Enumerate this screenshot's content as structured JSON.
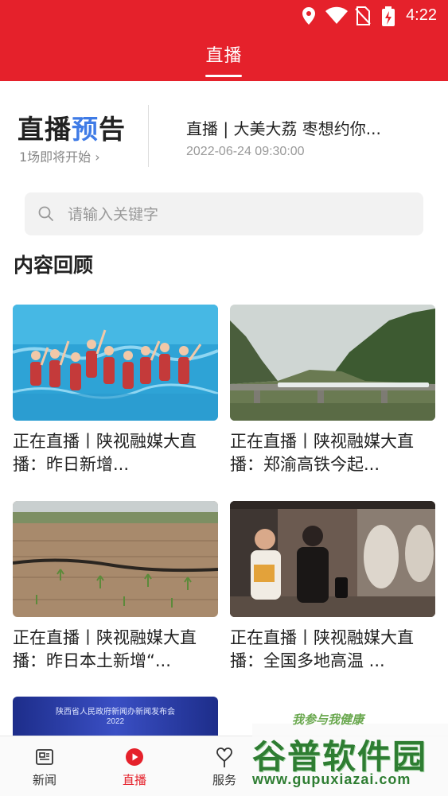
{
  "status_bar": {
    "time": "4:22"
  },
  "header": {
    "title": "直播"
  },
  "preview": {
    "title_part1": "直播",
    "title_part2": "预",
    "title_part3": "告",
    "subtitle": "1场即将开始 ›",
    "item_title": "直播 | 大美大荔 枣想约你...",
    "item_time": "2022-06-24 09:30:00"
  },
  "search": {
    "placeholder": "请输入关键字"
  },
  "section": {
    "title": "内容回顾"
  },
  "cards": [
    {
      "title": "正在直播丨陕视融媒大直播：昨日新增..."
    },
    {
      "title": "正在直播丨陕视融媒大直播：郑渝高铁今起..."
    },
    {
      "title": "正在直播丨陕视融媒大直播：昨日本土新增“..."
    },
    {
      "title": "正在直播丨陕视融媒大直播：全国多地高温 ..."
    }
  ],
  "partial_card": {
    "org": "陕西省人民政府新闻办新闻发布会",
    "year": "2022"
  },
  "tabs": [
    {
      "label": "新闻",
      "icon": "news-icon"
    },
    {
      "label": "直播",
      "icon": "play-icon"
    },
    {
      "label": "服务",
      "icon": "heart-service-icon"
    }
  ],
  "watermark": {
    "text": "谷普软件园",
    "url": "www.gupuxiazai.com",
    "slogan": "我参与我健康"
  },
  "colors": {
    "accent": "#e5212b",
    "blue": "#3f7be6"
  }
}
